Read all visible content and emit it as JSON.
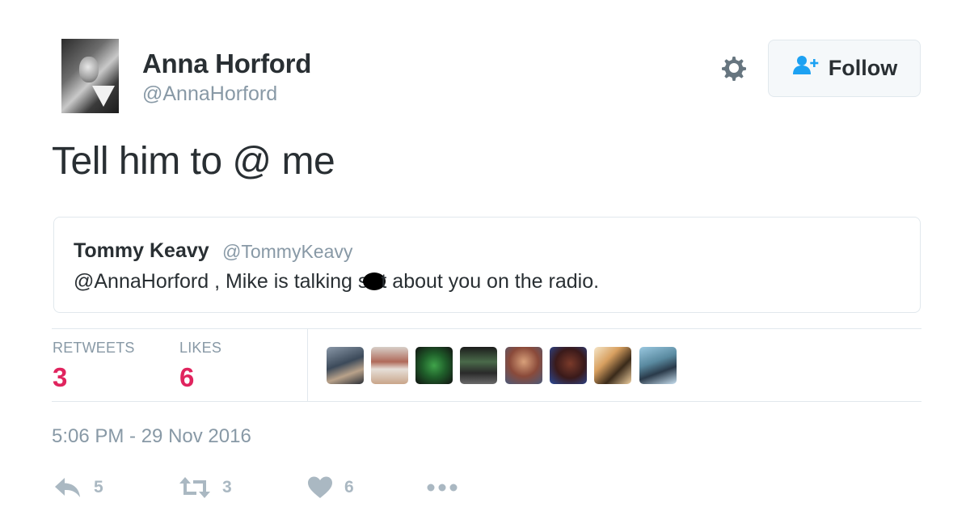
{
  "author": {
    "name": "Anna Horford",
    "handle": "@AnnaHorford"
  },
  "header": {
    "follow_label": "Follow",
    "gear_icon": "gear-icon",
    "follow_icon": "add-user-icon"
  },
  "tweet": {
    "text": "Tell him to @ me",
    "timestamp": "5:06 PM - 29 Nov 2016"
  },
  "quoted": {
    "name": "Tommy Keavy",
    "handle": "@TommyKeavy",
    "text_before": "@AnnaHorford , Mike is talking s",
    "text_after": "t about you on the radio."
  },
  "stats": {
    "retweets_label": "RETWEETS",
    "retweets_value": "3",
    "likes_label": "LIKES",
    "likes_value": "6"
  },
  "actions": {
    "reply_count": "5",
    "retweet_count": "3",
    "like_count": "6"
  },
  "colors": {
    "accent": "#1da1f2",
    "like": "#e0245e",
    "muted": "#8899a6",
    "border": "#e1e8ed"
  }
}
